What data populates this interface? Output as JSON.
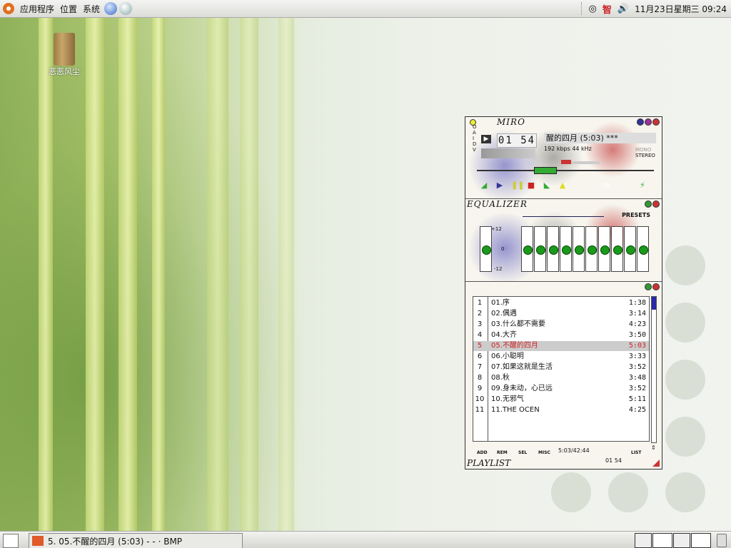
{
  "top_panel": {
    "menus": [
      "应用程序",
      "位置",
      "系统"
    ],
    "input_method": "智",
    "clock": "11月23日星期三 09:24"
  },
  "desktop": {
    "icon_label": "恶恶风尘"
  },
  "player": {
    "skin_name": "MIRO",
    "clutter_letters": "O A I D V",
    "time": "01 54",
    "song_title": "醒的四月 (5:03)  ***",
    "bitrate": "192 kbps 44 kHz",
    "mono": "MONO",
    "stereo": "STEREO",
    "eq": {
      "title": "EQUALIZER",
      "presets": "PRESETS",
      "plus": "+12",
      "zero": "0",
      "minus": "-12",
      "preamp_level": 0.5,
      "band_levels": [
        0.5,
        0.5,
        0.5,
        0.5,
        0.5,
        0.5,
        0.5,
        0.5,
        0.5,
        0.5
      ]
    },
    "playlist": {
      "title": "PLAYLIST",
      "items": [
        {
          "n": "1",
          "title": "01.序",
          "dur": "1:38"
        },
        {
          "n": "2",
          "title": "02.偶遇",
          "dur": "3:14"
        },
        {
          "n": "3",
          "title": "03.什么都不需要",
          "dur": "4:23"
        },
        {
          "n": "4",
          "title": "04.大齐",
          "dur": "3:50"
        },
        {
          "n": "5",
          "title": "05.不醒的四月",
          "dur": "5:03"
        },
        {
          "n": "6",
          "title": "06.小聪明",
          "dur": "3:33"
        },
        {
          "n": "7",
          "title": "07.如果这就是生活",
          "dur": "3:52"
        },
        {
          "n": "8",
          "title": "08.秋",
          "dur": "3:48"
        },
        {
          "n": "9",
          "title": "09.身未动，心已远",
          "dur": "3:52"
        },
        {
          "n": "10",
          "title": "10.无邪气",
          "dur": "5:11"
        },
        {
          "n": "11",
          "title": "11.THE OCEN",
          "dur": "4:25"
        }
      ],
      "current_index": 4,
      "buttons": [
        "ADD",
        "REM",
        "SEL",
        "MISC",
        "LIST"
      ],
      "total": "5:03/42:44",
      "mini_time": "01 54"
    }
  },
  "taskbar": {
    "task_label": "5. 05.不醒的四月 (5:03) - - · BMP"
  }
}
